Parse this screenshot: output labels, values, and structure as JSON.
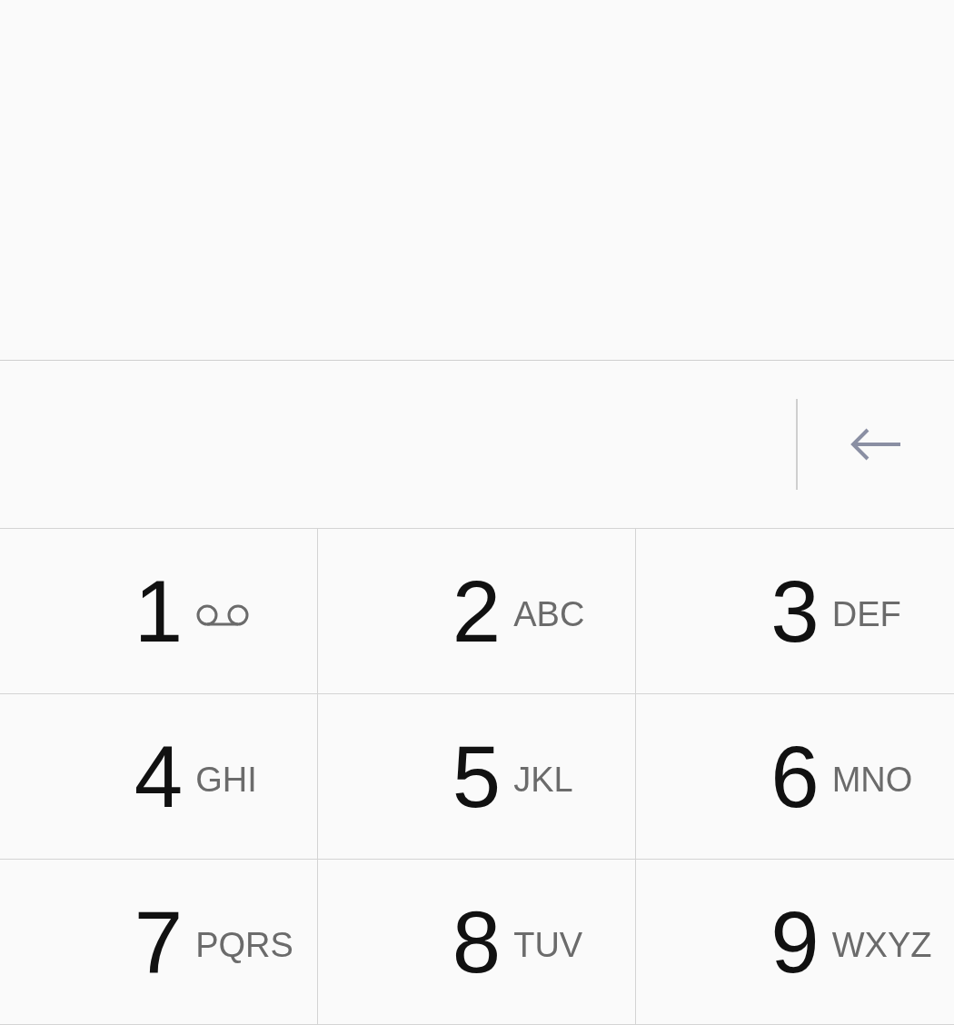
{
  "keypad": {
    "keys": [
      {
        "kind": "voicemail",
        "digit": "1"
      },
      {
        "kind": "letters",
        "digit": "2",
        "letters": "ABC"
      },
      {
        "kind": "letters",
        "digit": "3",
        "letters": "DEF"
      },
      {
        "kind": "letters",
        "digit": "4",
        "letters": "GHI"
      },
      {
        "kind": "letters",
        "digit": "5",
        "letters": "JKL"
      },
      {
        "kind": "letters",
        "digit": "6",
        "letters": "MNO"
      },
      {
        "kind": "letters",
        "digit": "7",
        "letters": "PQRS"
      },
      {
        "kind": "letters",
        "digit": "8",
        "letters": "TUV"
      },
      {
        "kind": "letters",
        "digit": "9",
        "letters": "WXYZ"
      }
    ]
  }
}
